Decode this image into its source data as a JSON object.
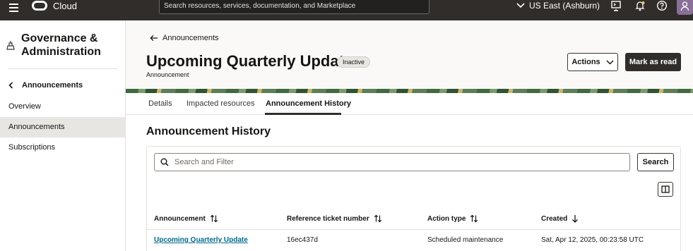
{
  "topbar": {
    "brand": "Cloud",
    "search_placeholder": "Search resources, services, documentation, and Marketplace",
    "region": "US East (Ashburn)"
  },
  "sidebar": {
    "title": "Governance & Administration",
    "back_label": "Announcements",
    "items": [
      {
        "label": "Overview",
        "active": false
      },
      {
        "label": "Announcements",
        "active": true
      },
      {
        "label": "Subscriptions",
        "active": false
      }
    ]
  },
  "header": {
    "breadcrumb": "Announcements",
    "title": "Upcoming Quarterly Update",
    "status": "Inactive",
    "subtitle": "Announcement",
    "actions_label": "Actions",
    "mark_read_label": "Mark as read"
  },
  "tabs": [
    {
      "label": "Details",
      "active": false
    },
    {
      "label": "Impacted resources",
      "active": false
    },
    {
      "label": "Announcement History",
      "active": true
    }
  ],
  "history": {
    "title": "Announcement History",
    "filter_placeholder": "Search and Filter",
    "search_label": "Search",
    "columns": [
      "Announcement",
      "Reference ticket number",
      "Action type",
      "Created"
    ],
    "rows": [
      {
        "announcement": "Upcoming Quarterly Update",
        "ticket": "16ec437d",
        "action": "Scheduled maintenance",
        "created": "Sat, Apr 12, 2025, 00:23:58 UTC"
      }
    ]
  },
  "colors": {
    "topbar_bg": "#312d2a",
    "link": "#00688c",
    "active_nav_bg": "#e8e6e3"
  }
}
